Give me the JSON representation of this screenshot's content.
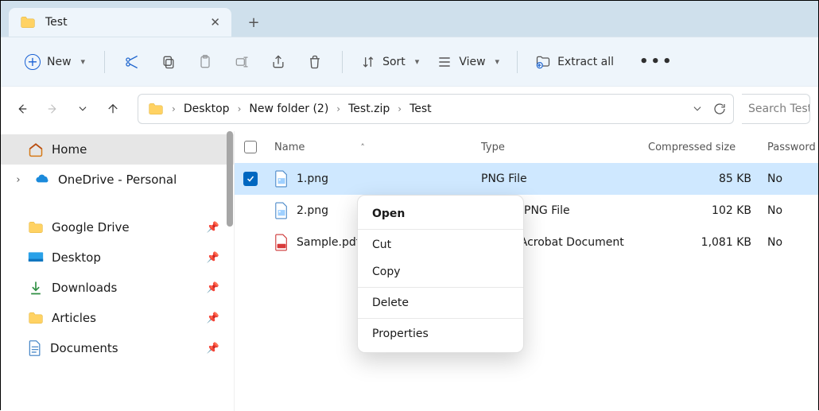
{
  "tab": {
    "title": "Test"
  },
  "toolbar": {
    "new_label": "New",
    "sort_label": "Sort",
    "view_label": "View",
    "extract_label": "Extract all"
  },
  "breadcrumbs": [
    "Desktop",
    "New folder (2)",
    "Test.zip",
    "Test"
  ],
  "search_placeholder": "Search Test",
  "sidebar": {
    "home": "Home",
    "onedrive": "OneDrive - Personal",
    "items": [
      {
        "label": "Google Drive"
      },
      {
        "label": "Desktop"
      },
      {
        "label": "Downloads"
      },
      {
        "label": "Articles"
      },
      {
        "label": "Documents"
      }
    ]
  },
  "columns": {
    "name": "Name",
    "type": "Type",
    "csize": "Compressed size",
    "password": "Password"
  },
  "files": [
    {
      "name": "1.png",
      "type": "PNG File",
      "csize": "85 KB",
      "pw": "No",
      "selected": true,
      "icon": "png"
    },
    {
      "name": "2.png",
      "type": "PNG File",
      "csize": "102 KB",
      "pw": "No",
      "selected": false,
      "icon": "png"
    },
    {
      "name": "Sample.pdf",
      "type": "Adobe Acrobat Document",
      "csize": "1,081 KB",
      "pw": "No",
      "selected": false,
      "icon": "pdf"
    }
  ],
  "context_menu": {
    "open": "Open",
    "cut": "Cut",
    "copy": "Copy",
    "delete": "Delete",
    "properties": "Properties"
  }
}
